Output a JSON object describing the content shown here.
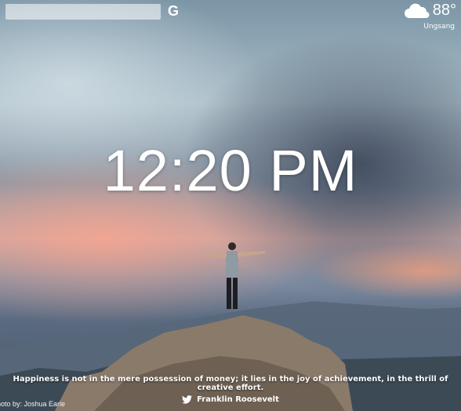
{
  "weather": {
    "icon": "cloud-icon",
    "temperature": "88°",
    "location": "Ungsang"
  },
  "search": {
    "engine_icon": "google-icon",
    "engine_letter": "G"
  },
  "clock": {
    "time": "12:20 PM"
  },
  "quote": {
    "text": "Happiness is not in the mere possession of money; it lies in the joy of achievement, in the thrill of creative effort.",
    "author": "Franklin Roosevelt",
    "author_icon": "twitter-icon"
  },
  "photo_credit": "hoto by: Joshua Earle"
}
